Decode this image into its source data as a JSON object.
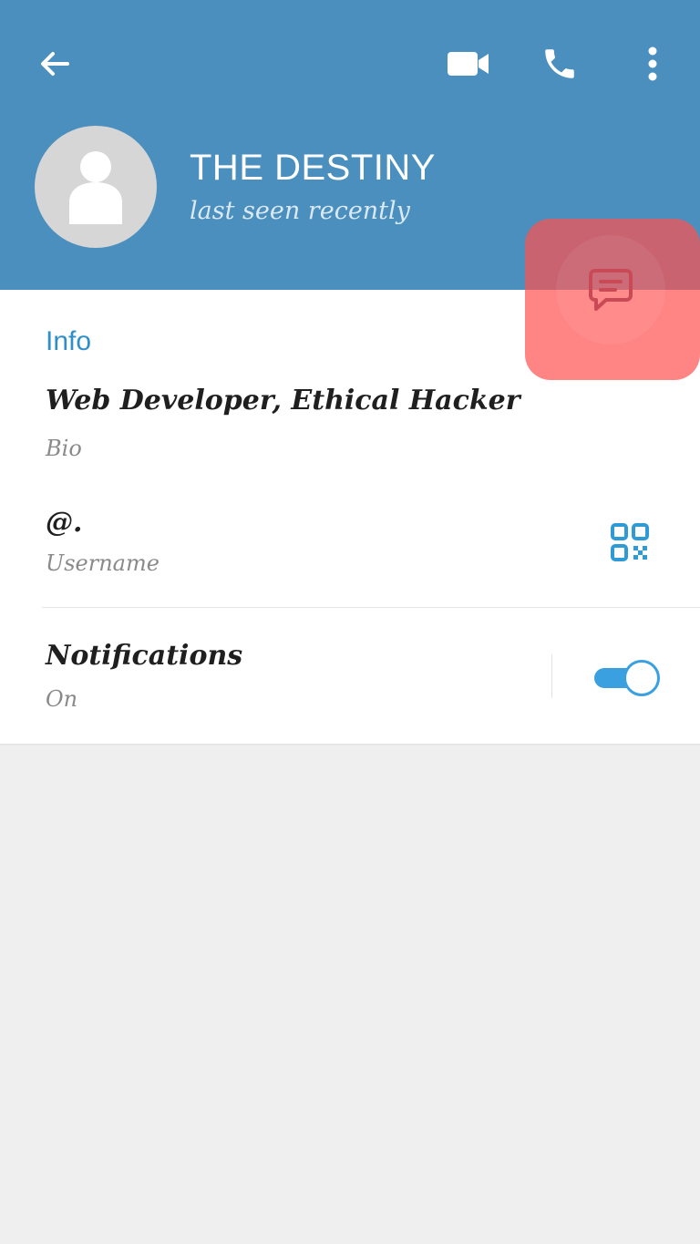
{
  "header": {
    "background_color": "#4a8fbd",
    "back_icon": "arrow-left-icon",
    "actions": [
      {
        "icon": "video-camera-icon"
      },
      {
        "icon": "phone-icon"
      },
      {
        "icon": "more-vert-icon"
      }
    ]
  },
  "profile": {
    "name": "THE DESTINY",
    "status": "last seen recently",
    "avatar_icon": "person-placeholder-icon"
  },
  "fab": {
    "icon": "message-icon",
    "highlight_color": "#ff5050"
  },
  "info": {
    "section_title": "Info",
    "bio": {
      "value": "Web Developer, Ethical Hacker",
      "label": "Bio"
    },
    "username": {
      "value": "@.",
      "label": "Username",
      "action_icon": "qr-code-icon"
    },
    "notifications": {
      "value": "Notifications",
      "label": "On",
      "toggle_on": true
    },
    "accent_color": "#3aa0e0"
  }
}
